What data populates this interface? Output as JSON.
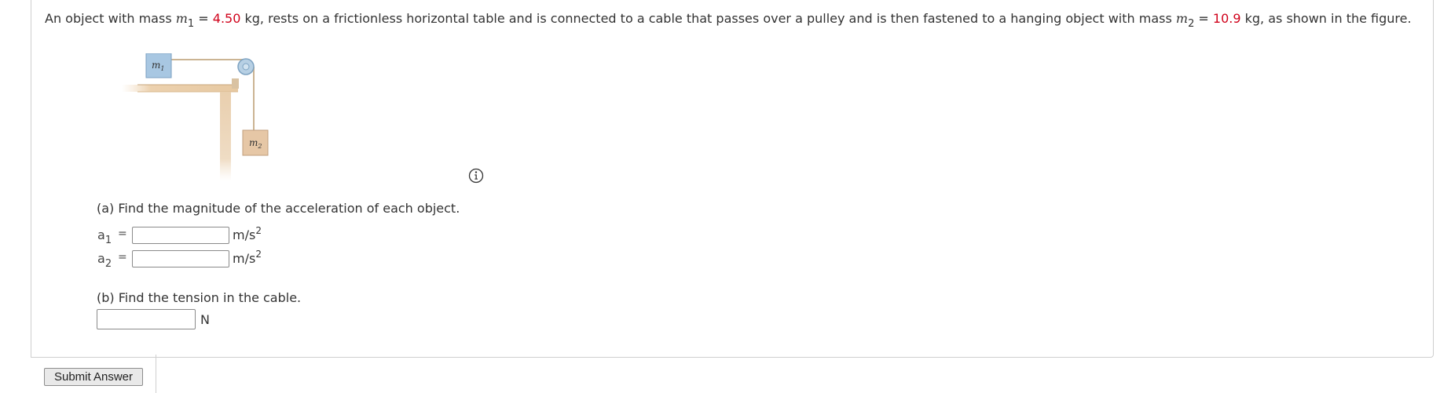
{
  "problem": {
    "text_1": "An object with mass ",
    "m1_var": "m",
    "m1_sub": "1",
    "eq1": " = ",
    "m1_value": "4.50",
    "text_2": " kg, rests on a frictionless horizontal table and is connected to a cable that passes over a pulley and is then fastened to a hanging object with mass ",
    "m2_var": "m",
    "m2_sub": "2",
    "eq2": " = ",
    "m2_value": "10.9",
    "text_3": " kg, as shown in the figure.",
    "value_color": "#d0021b"
  },
  "figure": {
    "block1_label": "m",
    "block1_sub": "1",
    "block2_label": "m",
    "block2_sub": "2"
  },
  "info_icon": {
    "name": "info-icon"
  },
  "part_a": {
    "question": "(a) Find the magnitude of the acceleration of each object.",
    "a1_var": "a",
    "a1_sub": "1",
    "a2_var": "a",
    "a2_sub": "2",
    "eq": "=",
    "unit_base": "m/s",
    "unit_exp": "2",
    "a1_value": "",
    "a2_value": ""
  },
  "part_b": {
    "question": "(b) Find the tension in the cable.",
    "unit": "N",
    "value": ""
  },
  "submit": {
    "label": "Submit Answer"
  }
}
